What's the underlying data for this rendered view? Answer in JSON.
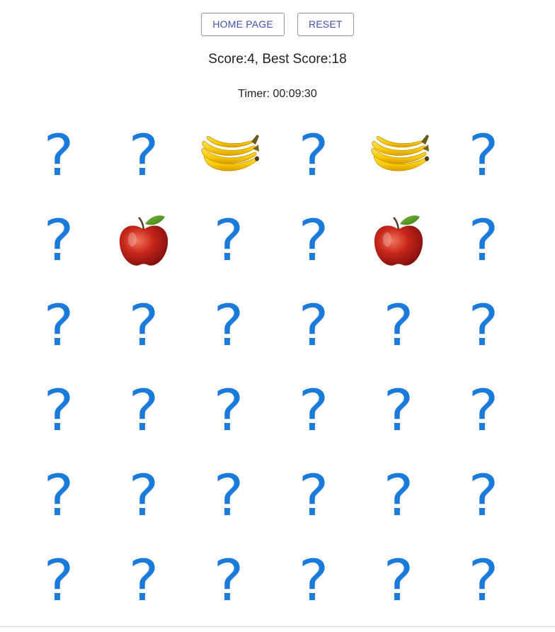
{
  "toolbar": {
    "home_label": "HOME PAGE",
    "reset_label": "RESET"
  },
  "status": {
    "score_text": "Score:4, Best Score:18",
    "timer_text": "Timer: 00:09:30"
  },
  "board": {
    "rows": 6,
    "columns": 6,
    "hidden_symbol": "?",
    "cards": [
      "hidden",
      "hidden",
      "banana",
      "hidden",
      "banana",
      "hidden",
      "hidden",
      "apple",
      "hidden",
      "hidden",
      "apple",
      "hidden",
      "hidden",
      "hidden",
      "hidden",
      "hidden",
      "hidden",
      "hidden",
      "hidden",
      "hidden",
      "hidden",
      "hidden",
      "hidden",
      "hidden",
      "hidden",
      "hidden",
      "hidden",
      "hidden",
      "hidden",
      "hidden",
      "hidden",
      "hidden",
      "hidden",
      "hidden",
      "hidden",
      "hidden"
    ]
  },
  "colors": {
    "question_mark": "#1a7bdc",
    "button_border": "#8e95c9",
    "button_text": "#3f51b5"
  },
  "icons": {
    "banana": "banana-icon",
    "apple": "apple-icon"
  }
}
